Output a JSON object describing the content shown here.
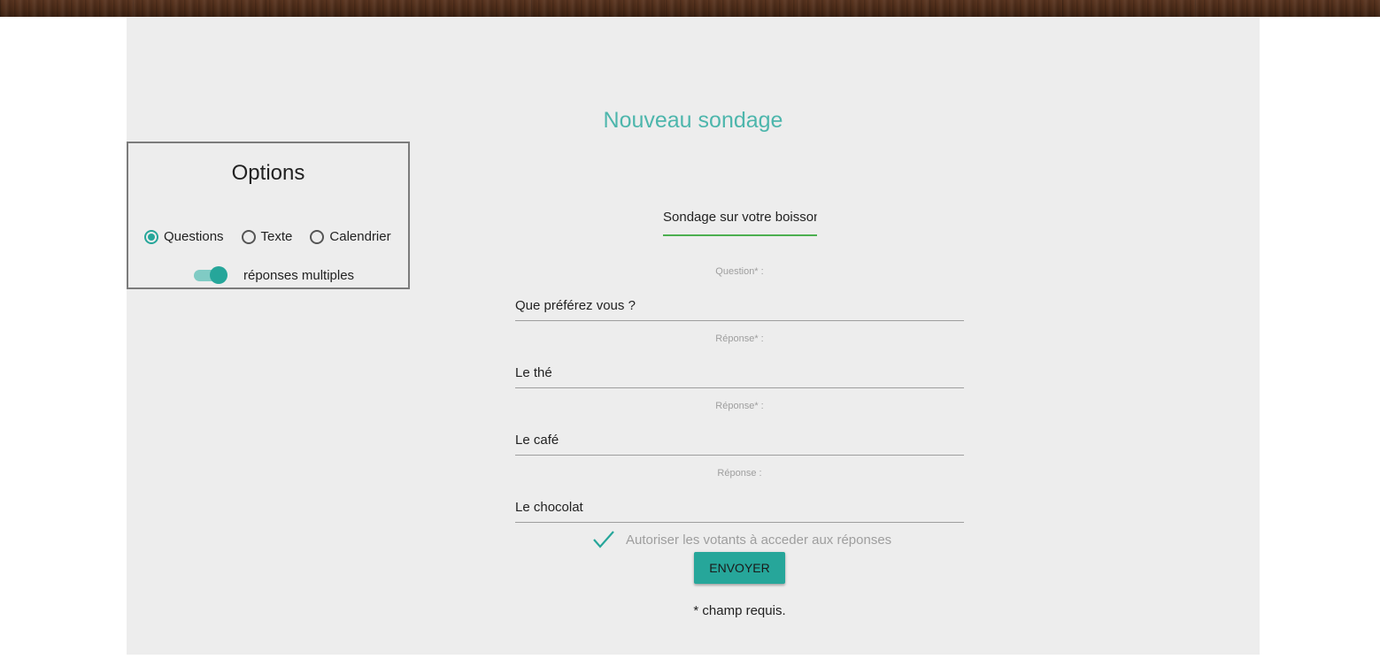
{
  "header": {
    "wood_bar": "wood-texture"
  },
  "form": {
    "title": "Nouveau sondage",
    "survey_name_value": "Sondage sur votre boisson",
    "question_label": "Question* :",
    "question_value": "Que préférez vous ?",
    "answers": [
      {
        "label": "Réponse* :",
        "value": "Le thé"
      },
      {
        "label": "Réponse* :",
        "value": "Le café"
      },
      {
        "label": "Réponse :",
        "value": "Le chocolat"
      }
    ],
    "allow_access_label": "Autoriser les votants à acceder aux réponses",
    "allow_access_checked": true,
    "submit_label": "ENVOYER",
    "required_note": "* champ requis."
  },
  "options": {
    "title": "Options",
    "types": [
      {
        "label": "Questions",
        "selected": true
      },
      {
        "label": "Texte",
        "selected": false
      },
      {
        "label": "Calendrier",
        "selected": false
      }
    ],
    "multiple_answers_label": "réponses multiples",
    "multiple_answers_on": true
  },
  "colors": {
    "accent": "#26a69a",
    "title": "#4db6ac",
    "active_underline": "#4caf50",
    "panel_bg": "#ededed"
  }
}
